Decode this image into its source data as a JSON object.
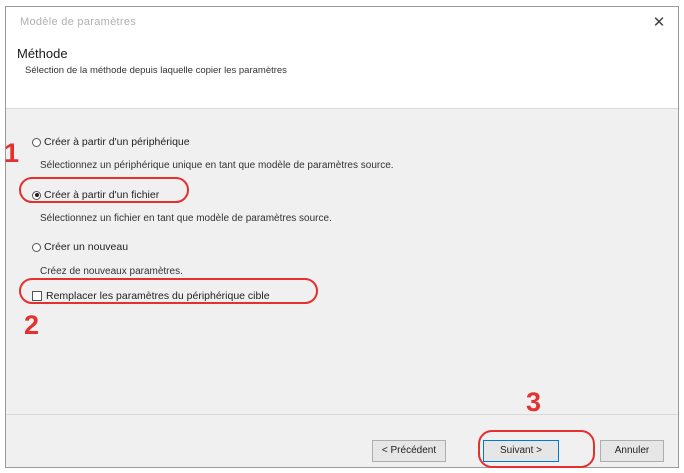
{
  "window": {
    "title": "Modèle de paramètres"
  },
  "header": {
    "title": "Méthode",
    "subtitle": "Sélection de la méthode depuis laquelle copier les paramètres"
  },
  "options": [
    {
      "label": "Créer à partir d'un périphérique",
      "description": "Sélectionnez un périphérique unique en tant que modèle de paramètres source.",
      "selected": false
    },
    {
      "label": "Créer à partir d'un fichier",
      "description": "Sélectionnez un fichier en tant que modèle de paramètres source.",
      "selected": true
    },
    {
      "label": "Créer un nouveau",
      "description": "Créez de nouveaux paramètres.",
      "selected": false
    }
  ],
  "replace_checkbox": {
    "label": "Remplacer les paramètres du périphérique cible",
    "checked": false
  },
  "steps": [
    "1",
    "2",
    "3"
  ],
  "buttons": {
    "back": "< Précédent",
    "next": "Suivant >",
    "cancel": "Annuler"
  },
  "icons": {
    "close": "close-icon"
  },
  "colors": {
    "highlight": "#e4302f",
    "background": "#f0f0f0",
    "primary_border": "#0078d7"
  }
}
